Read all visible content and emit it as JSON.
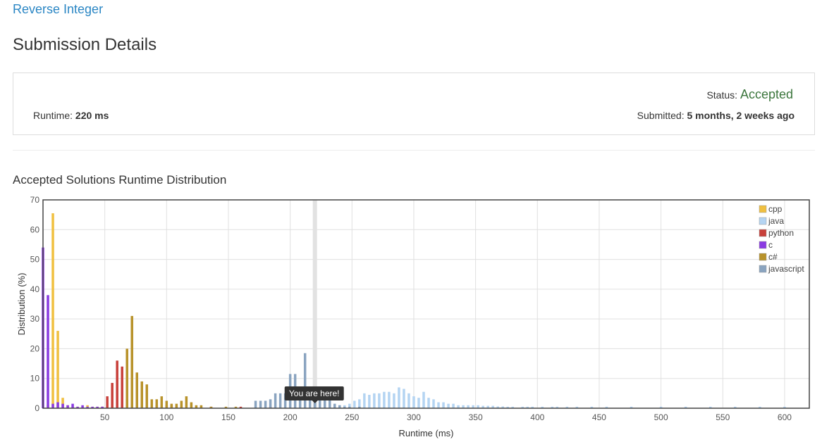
{
  "problem": {
    "title": "Reverse Integer"
  },
  "page": {
    "title": "Submission Details"
  },
  "summary": {
    "status_label": "Status:",
    "status_value": "Accepted",
    "runtime_label": "Runtime:",
    "runtime_value": "220 ms",
    "submitted_label": "Submitted:",
    "submitted_value": "5 months, 2 weeks ago"
  },
  "section": {
    "title": "Accepted Solutions Runtime Distribution"
  },
  "colors": {
    "cpp": "#f0c040",
    "java": "#b4d4f2",
    "python": "#c8403a",
    "c": "#8a3ae2",
    "c#": "#b8922a",
    "javascript": "#8aa4c0",
    "status_accepted": "#3c763d",
    "link": "#2a86c4"
  },
  "chart_data": {
    "type": "bar",
    "xlabel": "Runtime (ms)",
    "ylabel": "Distribution (%)",
    "xlim": [
      0,
      620
    ],
    "ylim": [
      0,
      70
    ],
    "xticks": [
      50,
      100,
      150,
      200,
      250,
      300,
      350,
      400,
      450,
      500,
      550,
      600
    ],
    "yticks": [
      0,
      10,
      20,
      30,
      40,
      50,
      60,
      70
    ],
    "grid": true,
    "legend_position": "top-right",
    "marker": {
      "x": 220,
      "label": "You are here!"
    },
    "series": [
      {
        "name": "cpp",
        "points": [
          [
            4,
            1
          ],
          [
            8,
            65.5
          ],
          [
            12,
            26
          ],
          [
            16,
            3.5
          ],
          [
            20,
            1
          ],
          [
            24,
            0.5
          ],
          [
            28,
            0.5
          ],
          [
            32,
            0.5
          ],
          [
            36,
            1
          ],
          [
            40,
            0.5
          ],
          [
            44,
            0.5
          ],
          [
            48,
            0.5
          ],
          [
            56,
            0.5
          ],
          [
            64,
            1
          ],
          [
            72,
            0.5
          ],
          [
            80,
            0.5
          ],
          [
            96,
            0.5
          ],
          [
            104,
            0.5
          ],
          [
            120,
            0.5
          ],
          [
            124,
            0.5
          ],
          [
            128,
            0.5
          ]
        ]
      },
      {
        "name": "java",
        "points": [
          [
            240,
            1
          ],
          [
            244,
            1
          ],
          [
            248,
            1.5
          ],
          [
            252,
            2.5
          ],
          [
            256,
            3
          ],
          [
            260,
            5
          ],
          [
            264,
            4.5
          ],
          [
            268,
            5
          ],
          [
            272,
            5
          ],
          [
            276,
            5.5
          ],
          [
            280,
            5.5
          ],
          [
            284,
            5
          ],
          [
            288,
            7
          ],
          [
            292,
            6.5
          ],
          [
            296,
            5
          ],
          [
            300,
            4
          ],
          [
            304,
            3.5
          ],
          [
            308,
            5.5
          ],
          [
            312,
            3.5
          ],
          [
            316,
            3
          ],
          [
            320,
            2
          ],
          [
            324,
            2
          ],
          [
            328,
            1.5
          ],
          [
            332,
            1.5
          ],
          [
            336,
            1
          ],
          [
            340,
            1
          ],
          [
            344,
            1
          ],
          [
            348,
            1
          ],
          [
            352,
            1
          ],
          [
            356,
            0.8
          ],
          [
            360,
            0.8
          ],
          [
            364,
            0.8
          ],
          [
            368,
            0.6
          ],
          [
            372,
            0.6
          ],
          [
            376,
            0.5
          ],
          [
            380,
            0.5
          ],
          [
            388,
            0.5
          ],
          [
            392,
            0.5
          ],
          [
            396,
            0.5
          ],
          [
            404,
            0.5
          ],
          [
            412,
            0.5
          ],
          [
            416,
            0.5
          ],
          [
            424,
            0.5
          ],
          [
            432,
            0.5
          ],
          [
            444,
            0.5
          ],
          [
            456,
            0.5
          ],
          [
            476,
            0.5
          ],
          [
            500,
            0.5
          ],
          [
            520,
            0.5
          ],
          [
            540,
            0.5
          ],
          [
            560,
            0.5
          ],
          [
            580,
            0.5
          ],
          [
            600,
            0.5
          ]
        ]
      },
      {
        "name": "python",
        "points": [
          [
            48,
            0.5
          ],
          [
            52,
            4
          ],
          [
            56,
            8.5
          ],
          [
            60,
            16
          ],
          [
            64,
            14
          ],
          [
            68,
            3
          ],
          [
            72,
            0.5
          ],
          [
            76,
            1
          ],
          [
            80,
            0.5
          ],
          [
            84,
            0.5
          ],
          [
            88,
            0.5
          ],
          [
            92,
            1
          ],
          [
            96,
            0.5
          ],
          [
            100,
            1
          ],
          [
            104,
            1
          ],
          [
            108,
            0.5
          ],
          [
            112,
            0.5
          ],
          [
            136,
            0.5
          ],
          [
            160,
            0.5
          ],
          [
            184,
            0.5
          ]
        ]
      },
      {
        "name": "c",
        "points": [
          [
            0,
            54
          ],
          [
            4,
            38
          ],
          [
            8,
            1.5
          ],
          [
            12,
            2
          ],
          [
            16,
            1.5
          ],
          [
            20,
            1
          ],
          [
            24,
            1.5
          ],
          [
            28,
            0.5
          ],
          [
            32,
            1
          ],
          [
            36,
            0.5
          ],
          [
            40,
            0.5
          ],
          [
            44,
            0.5
          ],
          [
            48,
            0.5
          ]
        ]
      },
      {
        "name": "c#",
        "points": [
          [
            68,
            20
          ],
          [
            72,
            31
          ],
          [
            76,
            12
          ],
          [
            80,
            9
          ],
          [
            84,
            8
          ],
          [
            88,
            3
          ],
          [
            92,
            3
          ],
          [
            96,
            4
          ],
          [
            100,
            2.5
          ],
          [
            104,
            1.5
          ],
          [
            108,
            1.5
          ],
          [
            112,
            2.5
          ],
          [
            116,
            4
          ],
          [
            120,
            2
          ],
          [
            124,
            1
          ],
          [
            128,
            1
          ],
          [
            136,
            0.5
          ],
          [
            148,
            0.5
          ],
          [
            156,
            0.5
          ]
        ]
      },
      {
        "name": "javascript",
        "points": [
          [
            172,
            2.5
          ],
          [
            176,
            2.5
          ],
          [
            180,
            2.5
          ],
          [
            184,
            3
          ],
          [
            188,
            5
          ],
          [
            192,
            5
          ],
          [
            196,
            5
          ],
          [
            200,
            11.5
          ],
          [
            204,
            11.5
          ],
          [
            208,
            6
          ],
          [
            212,
            18.5
          ],
          [
            216,
            7
          ],
          [
            220,
            7
          ],
          [
            224,
            6
          ],
          [
            228,
            3.5
          ],
          [
            232,
            3
          ],
          [
            236,
            1.5
          ],
          [
            240,
            1
          ],
          [
            244,
            0.5
          ],
          [
            248,
            0.5
          ],
          [
            256,
            0.5
          ]
        ]
      }
    ]
  }
}
